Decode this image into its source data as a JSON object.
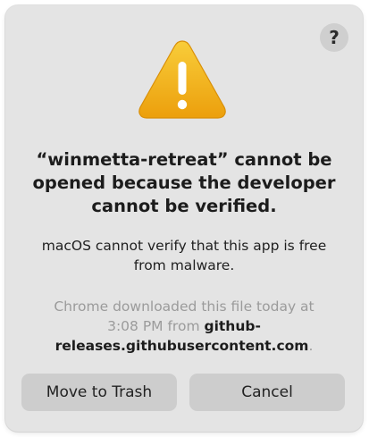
{
  "dialog": {
    "help_label": "?",
    "icon": "warning-triangle-icon",
    "title_line_1": "“winmetta-retreat” cannot be",
    "title_line_2": "opened because the developer",
    "title_line_3": "cannot be verified.",
    "message_line_1": "macOS cannot verify that this app is free",
    "message_line_2": "from malware.",
    "detail_prefix": "Chrome downloaded this file today at",
    "detail_time": "3:08 PM from ",
    "detail_source_1": "github-",
    "detail_source_2": "releases.githubusercontent.com",
    "detail_suffix": ".",
    "buttons": {
      "trash": "Move to Trash",
      "cancel": "Cancel"
    }
  },
  "colors": {
    "dialog_bg": "#e4e4e4",
    "button_bg": "#cdcdcd",
    "warning_yellow": "#f2b51a",
    "detail_gray": "#9b9b9b"
  }
}
